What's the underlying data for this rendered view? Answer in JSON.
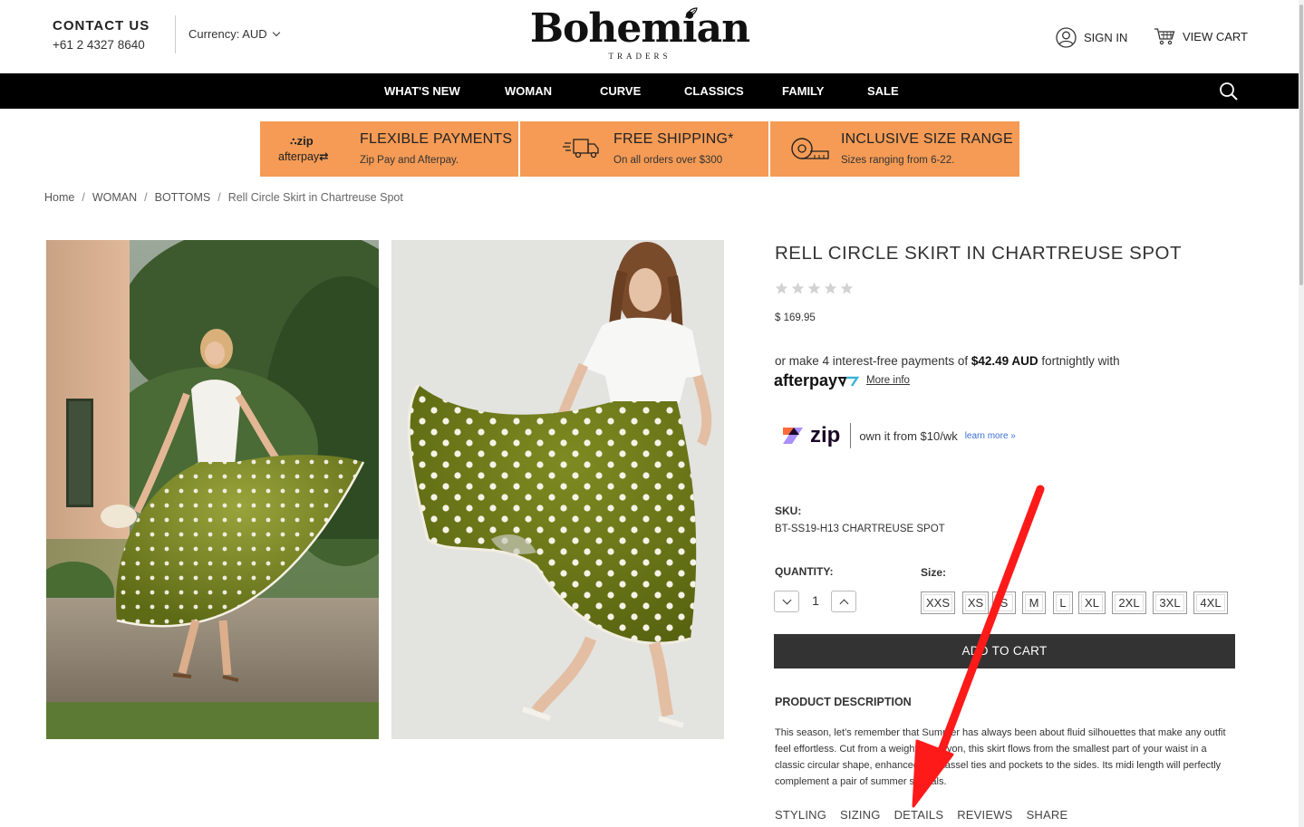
{
  "header": {
    "contact_title": "CONTACT US",
    "contact_phone": "+61 2 4327 8640",
    "currency_label": "Currency: AUD",
    "logo_main": "Bohemian",
    "logo_sub": "TRADERS",
    "sign_in": "SIGN IN",
    "view_cart": "VIEW CART"
  },
  "nav": {
    "items": [
      "WHAT'S NEW",
      "WOMAN",
      "CURVE",
      "CLASSICS",
      "FAMILY",
      "SALE"
    ]
  },
  "promos": [
    {
      "title": "FLEXIBLE PAYMENTS",
      "subtitle": "Zip Pay and Afterpay.",
      "icon": "zip-afterpay-logo"
    },
    {
      "title": "FREE SHIPPING*",
      "subtitle": "On all orders over $300",
      "icon": "truck-icon"
    },
    {
      "title": "INCLUSIVE SIZE RANGE",
      "subtitle": "Sizes ranging from 6-22.",
      "icon": "tape-measure-icon"
    }
  ],
  "promo_logo": {
    "zip": "zip",
    "afterpay": "afterpay"
  },
  "breadcrumb": {
    "items": [
      "Home",
      "WOMAN",
      "BOTTOMS"
    ],
    "current": "Rell Circle Skirt in Chartreuse Spot"
  },
  "product": {
    "title": "RELL CIRCLE SKIRT IN CHARTREUSE SPOT",
    "rating": 0,
    "price": "$ 169.95",
    "afterpay_pre": "or make 4 interest-free payments of ",
    "afterpay_amount": "$42.49 AUD",
    "afterpay_post": " fortnightly with",
    "afterpay_logo": "afterpay",
    "afterpay_more": "More info",
    "zip_logo": "zip",
    "zip_text": "own it from $10/wk",
    "zip_learn": "learn more »",
    "sku_label": "SKU:",
    "sku_value": "BT-SS19-H13 CHARTREUSE SPOT",
    "quantity_label": "QUANTITY:",
    "quantity": "1",
    "size_label": "Size:",
    "sizes": [
      "XXS",
      "XS",
      "S",
      "M",
      "L",
      "XL",
      "2XL",
      "3XL",
      "4XL"
    ],
    "add_to_cart": "ADD TO CART",
    "description_title": "PRODUCT DESCRIPTION",
    "description": "This season, let’s remember that Summer has always been about fluid silhouettes that make any outfit feel effortless. Cut from a weightless rayon, this skirt flows from the smallest part of your waist in a classic circular shape, enhanced with tassel ties and pockets to the sides. Its midi length will perfectly complement a pair of summer sandals.",
    "tabs": [
      "STYLING",
      "SIZING",
      "DETAILS",
      "REVIEWS",
      "SHARE"
    ]
  },
  "colors": {
    "promo_bg": "#f59b55",
    "nav_bg": "#000000",
    "button_bg": "#333333",
    "skirt_green": "#6e7c1c",
    "annotation_arrow": "#ff1a1a"
  }
}
